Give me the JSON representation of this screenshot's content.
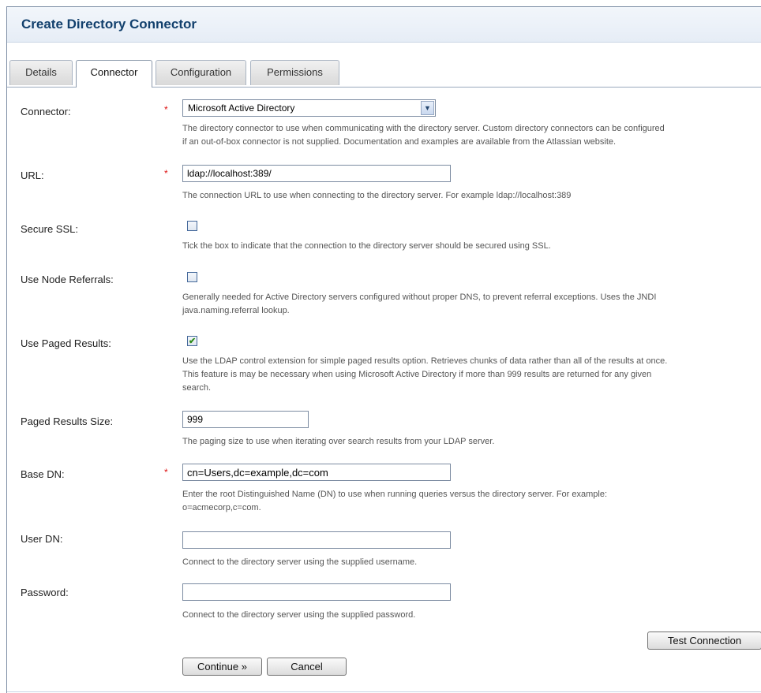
{
  "page": {
    "title": "Create Directory Connector"
  },
  "tabs": [
    {
      "label": "Details",
      "active": false
    },
    {
      "label": "Connector",
      "active": true
    },
    {
      "label": "Configuration",
      "active": false
    },
    {
      "label": "Permissions",
      "active": false
    }
  ],
  "form": {
    "connector": {
      "label": "Connector:",
      "required": "*",
      "value": "Microsoft Active Directory",
      "desc1": "The directory connector to use when communicating with the directory server. Custom directory connectors can be configured",
      "desc2": "if an out-of-box connector is not supplied. Documentation and examples are available from the Atlassian website."
    },
    "url": {
      "label": "URL:",
      "required": "*",
      "value": "ldap://localhost:389/",
      "desc1": "The connection URL to use when connecting to the directory server. For example ldap://localhost:389"
    },
    "secure_ssl": {
      "label": "Secure SSL:",
      "checked": false,
      "desc1": "Tick the box to indicate that the connection to the directory server should be secured using SSL."
    },
    "node_referrals": {
      "label": "Use Node Referrals:",
      "checked": false,
      "desc1": "Generally needed for Active Directory servers configured without proper DNS, to prevent referral exceptions. Uses the JNDI",
      "desc2": "java.naming.referral lookup."
    },
    "paged_results": {
      "label": "Use Paged Results:",
      "checked": true,
      "checkmark": "✔",
      "desc1": "Use the LDAP control extension for simple paged results option. Retrieves chunks of data rather than all of the results at once.",
      "desc2": "This feature is may be necessary when using Microsoft Active Directory if more than 999 results are returned for any given",
      "desc3": "search."
    },
    "paged_results_size": {
      "label": "Paged Results Size:",
      "value": "999",
      "desc1": "The paging size to use when iterating over search results from your LDAP server."
    },
    "base_dn": {
      "label": "Base DN:",
      "required": "*",
      "value": "cn=Users,dc=example,dc=com",
      "desc1": "Enter the root Distinguished Name (DN) to use when running queries versus the directory server. For example:",
      "desc2": "o=acmecorp,c=com."
    },
    "user_dn": {
      "label": "User DN:",
      "value": "",
      "desc1": "Connect to the directory server using the supplied username."
    },
    "password": {
      "label": "Password:",
      "value": "",
      "desc1": "Connect to the directory server using the supplied password."
    }
  },
  "buttons": {
    "test_connection": "Test Connection",
    "continue": "Continue »",
    "cancel": "Cancel"
  },
  "icons": {
    "dropdown": "chevron-down-icon",
    "dropdown_glyph": "▼"
  },
  "colors": {
    "title": "#12406d",
    "required": "#dd1111",
    "check": "#2d8a18"
  }
}
